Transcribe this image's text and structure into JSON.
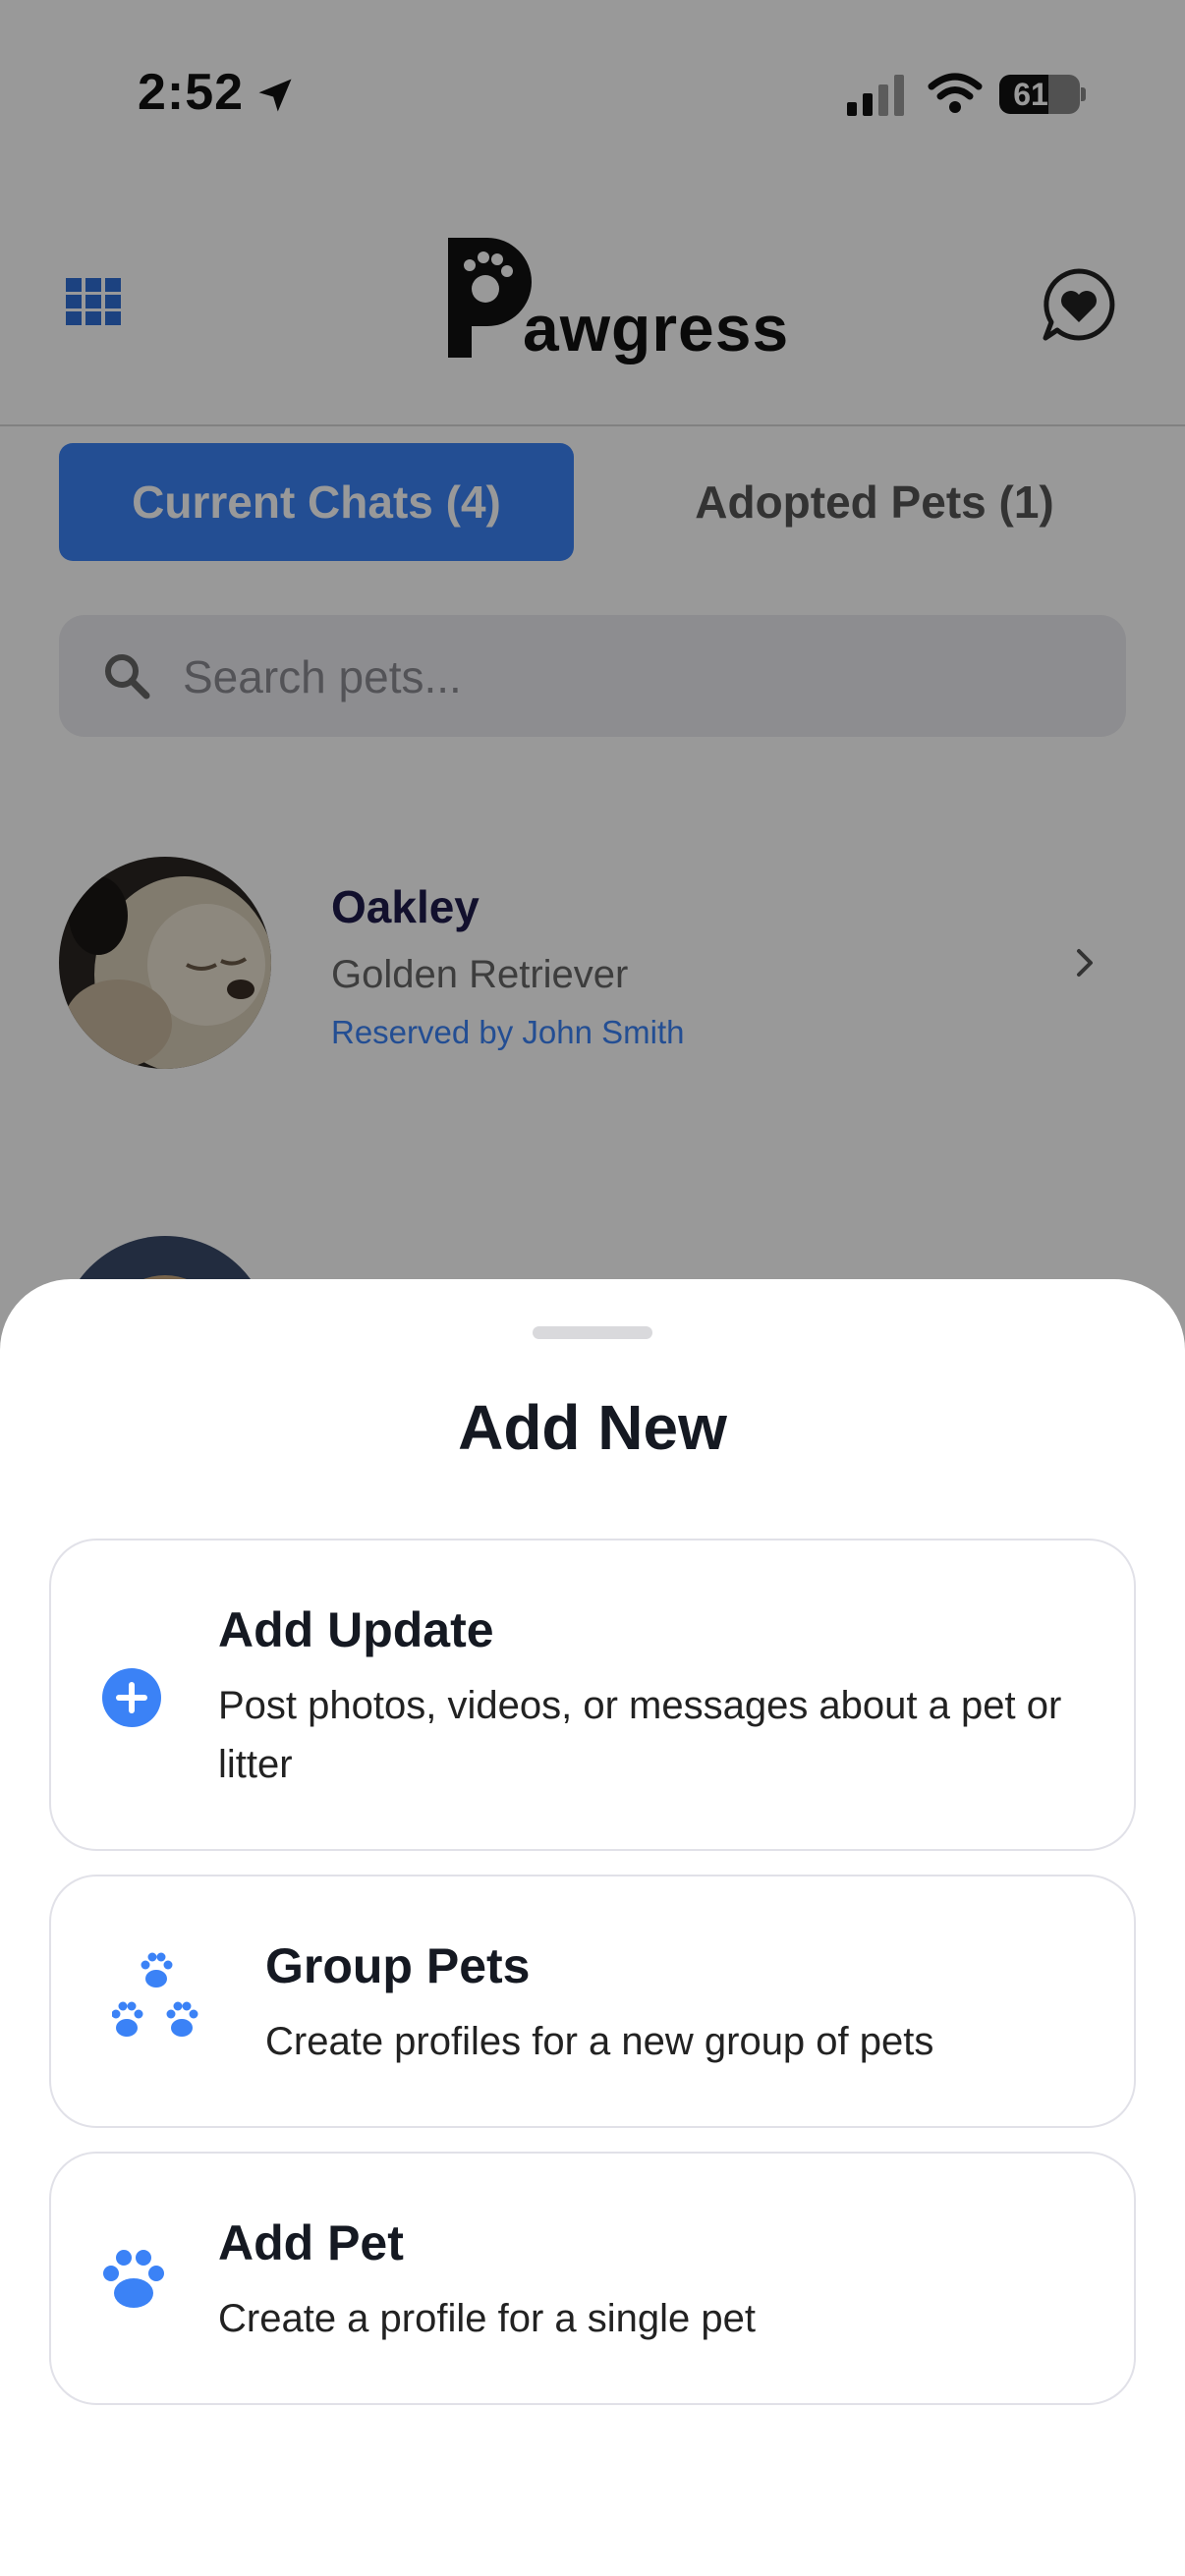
{
  "status_bar": {
    "time": "2:52",
    "battery": "61",
    "battery_level": 0.61
  },
  "header": {
    "logo_text": "awgress",
    "menu_icon": "grid-icon",
    "chat_icon": "chat-heart-icon"
  },
  "tabs": {
    "current": "Current Chats (4)",
    "adopted": "Adopted Pets (1)"
  },
  "search": {
    "placeholder": "Search pets..."
  },
  "pets": [
    {
      "name": "Oakley",
      "breed": "Golden Retriever",
      "status": "Reserved by John Smith"
    }
  ],
  "sheet": {
    "title": "Add New",
    "options": [
      {
        "title": "Add Update",
        "description": "Post photos, videos, or messages about a pet or litter",
        "icon": "plus-circle-icon"
      },
      {
        "title": "Group Pets",
        "description": "Create profiles for a new group of pets",
        "icon": "paw-group-icon"
      },
      {
        "title": "Add Pet",
        "description": "Create a profile for a single pet",
        "icon": "paw-icon"
      }
    ]
  },
  "colors": {
    "accent": "#3B82F6",
    "text_dark": "#151922",
    "name_color": "#1e1b4b"
  }
}
